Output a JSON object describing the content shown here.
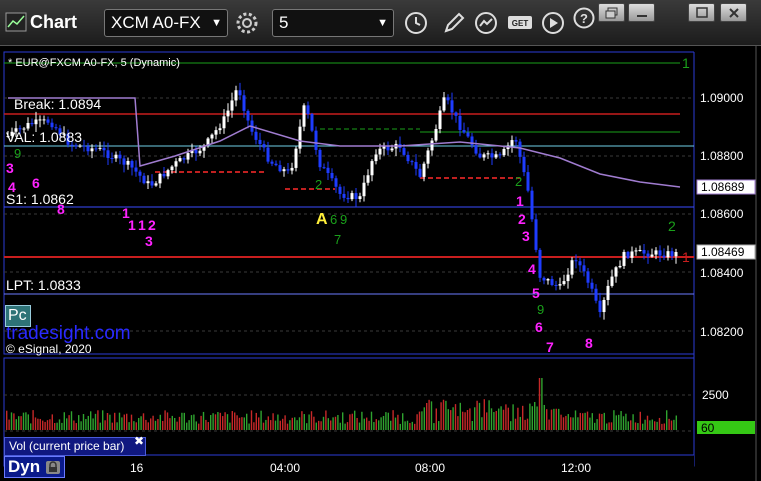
{
  "window": {
    "title": "Chart",
    "symbol": "XCM A0-FX",
    "interval": "5"
  },
  "chart": {
    "header": "* EUR@FXCM A0-FX, 5 (Dynamic)",
    "y_ticks": [
      "1.09000",
      "1.08800",
      "1.08600",
      "1.08400",
      "1.08200"
    ],
    "x_ticks": [
      "16",
      "04:00",
      "08:00",
      "12:00"
    ],
    "price_tags": [
      "1.08689",
      "1.08469"
    ],
    "levels": {
      "break": "Break: 1.0894",
      "val": "VAL: 1.0883",
      "s1": "S1: 1.0862",
      "lpt": "LPT: 1.0833"
    },
    "watermark": "tradesight.com",
    "copyright": "© eSignal, 2020",
    "pc_label": "Pc",
    "edge_labels": [
      "1",
      "2",
      "1"
    ],
    "signal_a": "A",
    "magenta_counts": [
      "3",
      "4",
      "6",
      "8",
      "1",
      "1",
      "2",
      "1",
      "3",
      "1",
      "2",
      "3",
      "4",
      "5",
      "6",
      "7",
      "8"
    ],
    "green_counts": [
      "9",
      "6",
      "7",
      "9",
      "2",
      "2",
      "9"
    ]
  },
  "volume": {
    "label": "Vol (current price bar)",
    "close_icon": "close-icon",
    "tick": "2500",
    "tag": "60"
  },
  "footer": {
    "dyn_label": "Dyn"
  },
  "colors": {
    "up_candle": "#ffffff",
    "down_candle": "#1e3cff",
    "break_line": "#c81e1e",
    "val_line": "#6fd0e8",
    "s1_line": "#3a4cff",
    "lpt_line": "#6b7bff",
    "ma_line": "#a07cd0",
    "green_line": "#1aa01a",
    "magenta": "#ff22ff",
    "volume_tag": "#35c815"
  }
}
